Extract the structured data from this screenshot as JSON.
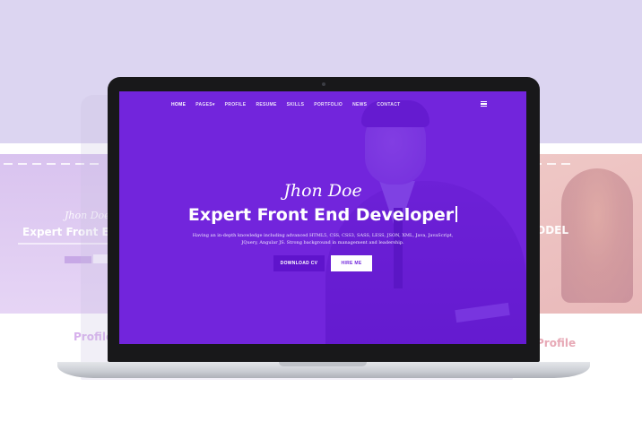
{
  "left_page": {
    "name": "Jhon Doe",
    "title": "Expert Front End",
    "section": "Profile"
  },
  "right_page": {
    "title": "ODEL",
    "section": "Profile"
  },
  "site": {
    "nav": [
      "HOME",
      "PAGES",
      "PROFILE",
      "RESUME",
      "SKILLS",
      "PORTFOLIO",
      "NEWS",
      "CONTACT"
    ],
    "hero": {
      "name": "Jhon Doe",
      "title": "Expert Front End Developer",
      "description": "Having an in-depth knowledge including advanced HTML5, CSS, CSS3, SASS, LESS, JSON, XML, Java, JavaScript, JQuery, Angular JS. Strong background in management and leadership.",
      "primary_button": "DOWNLOAD CV",
      "secondary_button": "HIRE ME"
    }
  },
  "colors": {
    "accent": "#7226dc",
    "background_top": "#dcd5f1"
  }
}
